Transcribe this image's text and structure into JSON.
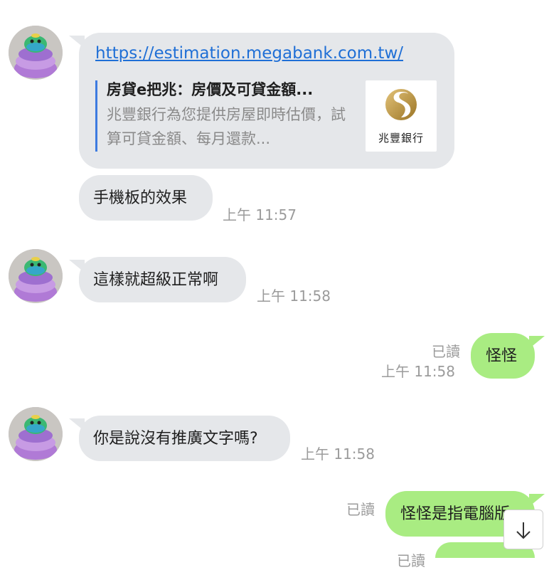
{
  "messages": {
    "m1": {
      "link": "https://estimation.megabank.com.tw/",
      "preview_title": "房貸e把兆：房價及可貸金額...",
      "preview_desc": "兆豐銀行為您提供房屋即時估價，試算可貸金額、每月還款...",
      "preview_brand": "兆豐銀行"
    },
    "m2": {
      "text": "手機板的效果",
      "time": "上午 11:57"
    },
    "m3": {
      "text": "這樣就超級正常啊",
      "time": "上午 11:58"
    },
    "m4": {
      "text": "怪怪",
      "read": "已讀",
      "time": "上午 11:58"
    },
    "m5": {
      "text": "你是說沒有推廣文字嗎?",
      "time": "上午 11:58"
    },
    "m6": {
      "text": "怪怪是指電腦版",
      "read": "已讀"
    },
    "m7": {
      "read": "已讀"
    }
  },
  "colors": {
    "incoming_bubble": "#e5e7ea",
    "outgoing_bubble": "#a9ec82",
    "link": "#1f6fd6",
    "timestamp": "#9b9b9b"
  },
  "icons": {
    "avatar": "green-character-on-purple-macaron-avatar",
    "scroll": "arrow-down-icon",
    "brand_logo": "megabank-s-logo"
  }
}
